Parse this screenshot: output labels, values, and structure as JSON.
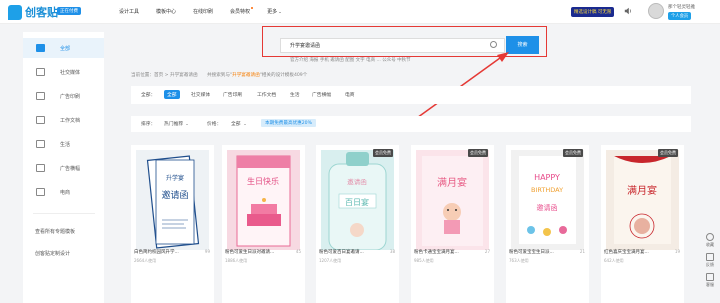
{
  "header": {
    "logo": "创客贴",
    "badge": "正在付费",
    "nav": [
      "设计工具",
      "模板中心",
      "在线印刷",
      "会员特权",
      "更多"
    ],
    "promo": "精选设计稿 可无限",
    "user": {
      "name": "那个轻灵轻雅",
      "tag": "个人会员"
    }
  },
  "sidebar": {
    "items": [
      {
        "label": "全部",
        "icon": "home-icon"
      },
      {
        "label": "社交媒体",
        "icon": "social-icon"
      },
      {
        "label": "广告印刷",
        "icon": "print-icon"
      },
      {
        "label": "工作文档",
        "icon": "document-icon"
      },
      {
        "label": "生活",
        "icon": "cup-icon"
      },
      {
        "label": "广告横幅",
        "icon": "banner-icon"
      },
      {
        "label": "电商",
        "icon": "shop-icon"
      }
    ],
    "extra": [
      "查看所有专题模板",
      "创客贴定制设计"
    ]
  },
  "search": {
    "value": "升学宴邀请函",
    "button": "搜索",
    "hot_words": "官方介绍  海报  手机  邀请函  配图  文字  电商  ... 公众号  中秋节"
  },
  "breadcrumb": {
    "prefix": "当前位置：",
    "home": "首页",
    "sep": " > ",
    "current": "升学宴邀请函",
    "result_pre": "共搜索到与\"",
    "keyword": "升学宴邀请函",
    "result_post": "\"相关的设计模板409个"
  },
  "filter": {
    "category_label": "全部：",
    "categories": [
      "全部",
      "社交媒体",
      "广告印刷",
      "工作文档",
      "生活",
      "广告横幅",
      "电商"
    ],
    "sort_label": "排序：",
    "sort_value": "热门推荐",
    "price_label": "价格：",
    "price_value": "全部",
    "notice": "本期免费最高优惠20%"
  },
  "cards": [
    {
      "title": "白色简约校园风升学...",
      "uses": "2664人使用",
      "count": "99",
      "free": ""
    },
    {
      "title": "粉色可爱生日派对邀请...",
      "uses": "1886人使用",
      "count": "45",
      "free": ""
    },
    {
      "title": "粉色可爱百日宴邀请...",
      "uses": "1207人使用",
      "count": "38",
      "free": "会员免费"
    },
    {
      "title": "粉色卡通宝宝满月宴...",
      "uses": "985人使用",
      "count": "27",
      "free": "会员免费"
    },
    {
      "title": "粉色可爱宝宝生日派...",
      "uses": "763人使用",
      "count": "21",
      "free": "会员免费"
    },
    {
      "title": "红色喜庆宝宝满月宴...",
      "uses": "642人使用",
      "count": "19",
      "free": "会员免费"
    }
  ],
  "rightbar": [
    "收藏",
    "反馈",
    "客服"
  ]
}
